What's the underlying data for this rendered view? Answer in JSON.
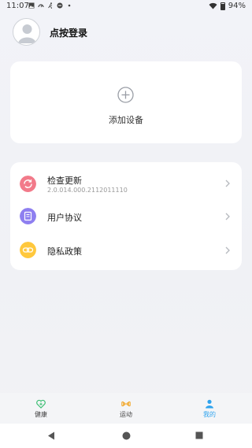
{
  "status_bar": {
    "time": "11:07",
    "battery": "94%"
  },
  "header": {
    "login_text": "点按登录"
  },
  "add_device": {
    "label": "添加设备"
  },
  "settings": {
    "items": [
      {
        "title": "检查更新",
        "subtitle": "2.0.014.000.2112011110",
        "icon": "refresh-icon",
        "color": "#f27a8a"
      },
      {
        "title": "用户协议",
        "subtitle": "",
        "icon": "document-icon",
        "color": "#8e7ff0"
      },
      {
        "title": "隐私政策",
        "subtitle": "",
        "icon": "link-icon",
        "color": "#ffc83d"
      }
    ]
  },
  "bottom_nav": {
    "items": [
      {
        "label": "健康",
        "icon": "heart-icon",
        "color": "#3fbf75"
      },
      {
        "label": "运动",
        "icon": "dumbbell-icon",
        "color": "#f2a21b"
      },
      {
        "label": "我的",
        "icon": "person-icon",
        "color": "#2ea3ee",
        "selected": true
      }
    ]
  },
  "colors": {
    "background": "#f2f3f8",
    "accent": "#2ea3ee"
  }
}
